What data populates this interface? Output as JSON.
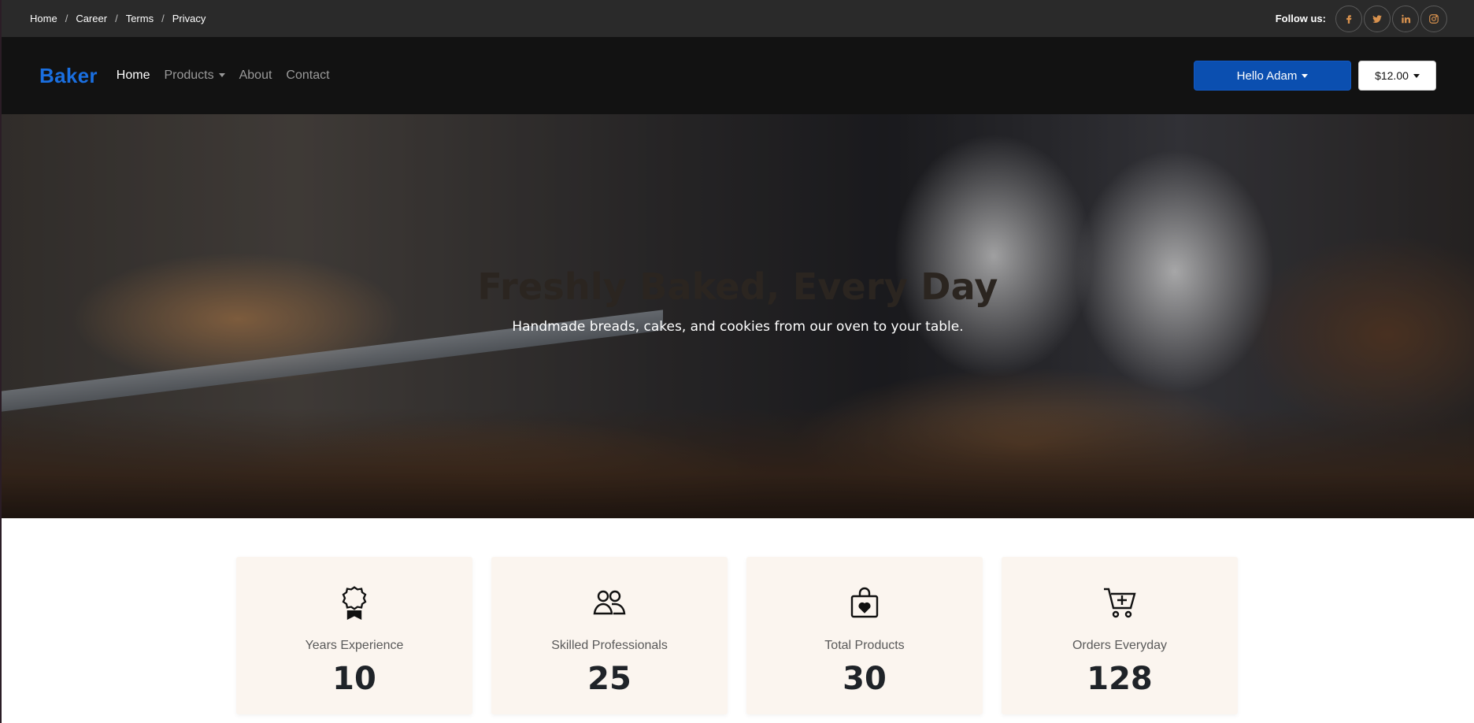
{
  "topbar": {
    "breadcrumbs": [
      "Home",
      "Career",
      "Terms",
      "Privacy"
    ],
    "separator": "/",
    "follow_label": "Follow us:",
    "social": [
      {
        "name": "facebook-icon",
        "glyph": "f"
      },
      {
        "name": "twitter-icon",
        "glyph": "t"
      },
      {
        "name": "linkedin-icon",
        "glyph": "in"
      },
      {
        "name": "instagram-icon",
        "glyph": "ig"
      }
    ],
    "social_color": "#d9924e"
  },
  "navbar": {
    "brand": "Baker",
    "brand_color": "#1a6fe0",
    "links": [
      {
        "label": "Home",
        "active": true
      },
      {
        "label": "Products",
        "dropdown": true
      },
      {
        "label": "About"
      },
      {
        "label": "Contact"
      }
    ],
    "user_button": "Hello Adam",
    "cart_button": "$12.00"
  },
  "hero": {
    "title": "Freshly Baked, Every Day",
    "subtitle": "Handmade breads, cakes, and cookies from our oven to your table."
  },
  "stats": [
    {
      "icon": "award-icon",
      "label": "Years Experience",
      "value": "10"
    },
    {
      "icon": "people-icon",
      "label": "Skilled Professionals",
      "value": "25"
    },
    {
      "icon": "shopping-bag-icon",
      "label": "Total Products",
      "value": "30"
    },
    {
      "icon": "cart-plus-icon",
      "label": "Orders Everyday",
      "value": "128"
    }
  ]
}
